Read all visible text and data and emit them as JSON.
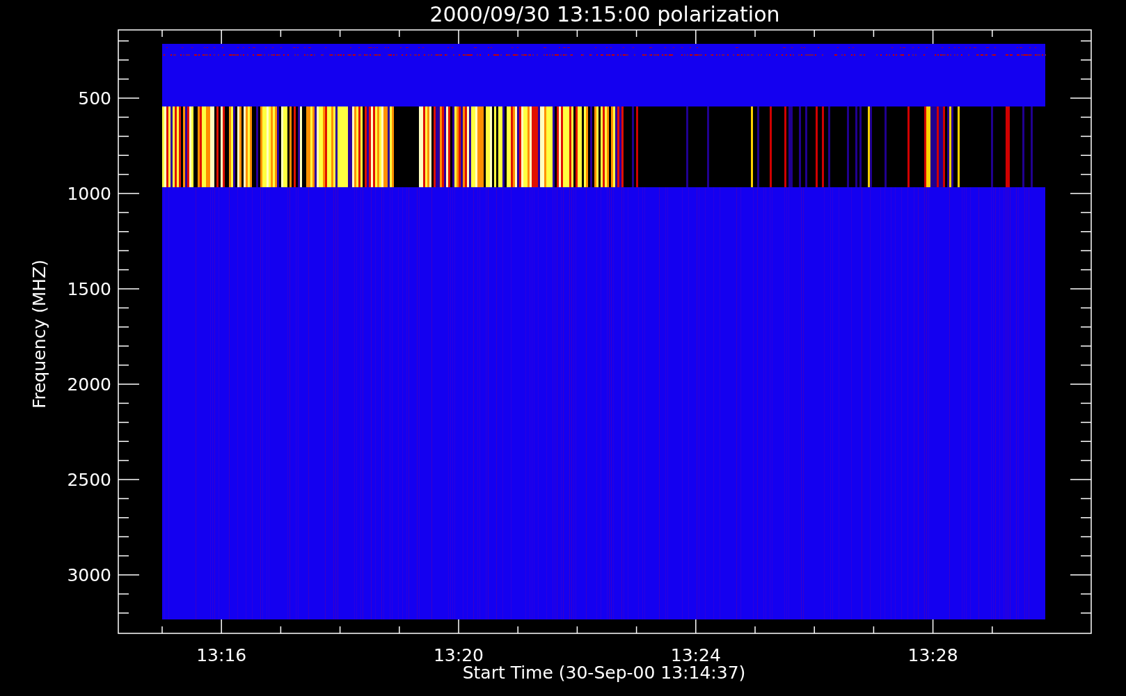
{
  "title": "2000/09/30 13:15:00 polarization",
  "x_axis": {
    "label": "Start Time (30-Sep-00 13:14:37)",
    "ticks": [
      "13:16",
      "13:20",
      "13:24",
      "13:28"
    ]
  },
  "y_axis": {
    "label": "Frequency (MHZ)",
    "ticks": [
      "500",
      "1000",
      "1500",
      "2000",
      "2500",
      "3000"
    ]
  }
}
